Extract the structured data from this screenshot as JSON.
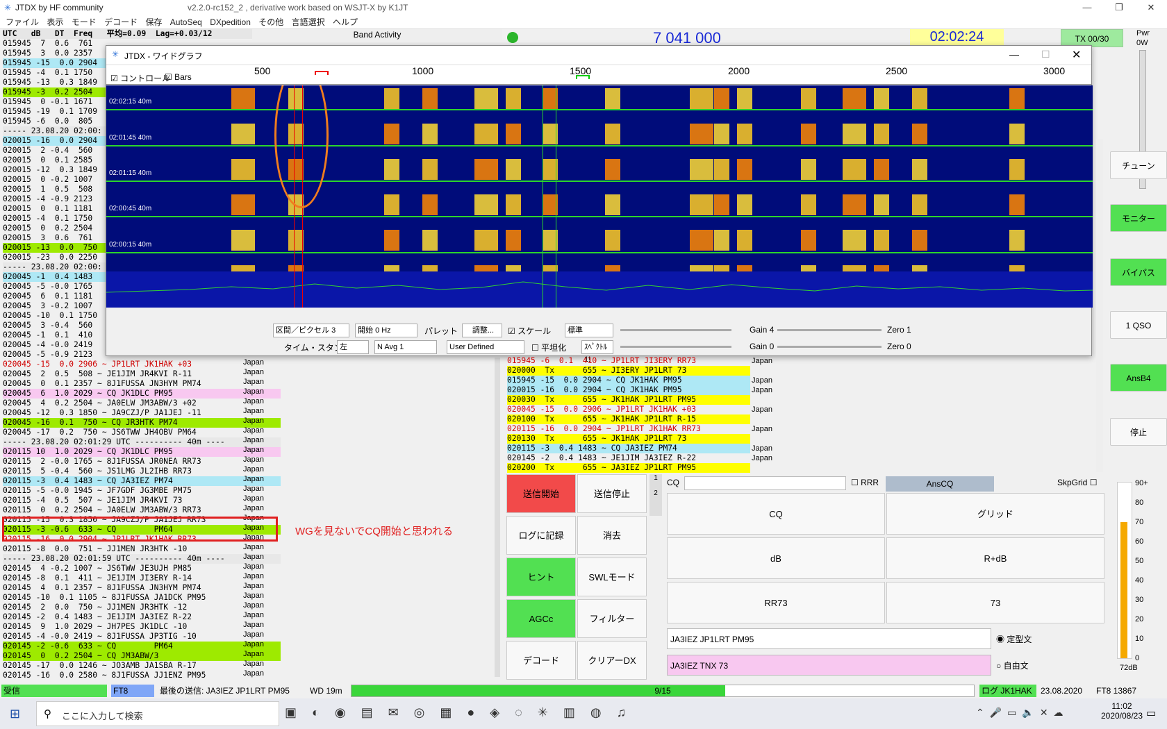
{
  "app": {
    "title": "JTDX  by HF community",
    "version": "v2.2.0-rc152_2 , derivative work based on WSJT-X by K1JT"
  },
  "menu": [
    "ファイル",
    "表示",
    "モード",
    "デコード",
    "保存",
    "AutoSeq",
    "DXpedition",
    "その他",
    "言語選択",
    "ヘルプ"
  ],
  "left_header": "UTC   dB   DT  Freq",
  "avg": "平均=0.09  Lag=+0.03/12",
  "band_activity": "Band Activity",
  "dial_freq": "7 041 000",
  "clock": "02:02:24",
  "tx_label": "TX 00/30",
  "pwr_label": "Pwr",
  "pwr_value": "0W",
  "right_buttons": [
    "チューン",
    "モニター",
    "バイパス",
    "1 QSO",
    "AnsB4",
    "停止"
  ],
  "annotation": "WGを見ないでCQ開始と思われる",
  "left_rows": [
    {
      "t": "015945  7  0.6  761",
      "c": ""
    },
    {
      "t": "015945  3  0.0 2357",
      "c": ""
    },
    {
      "t": "015945 -15  0.0 2904",
      "c": "cq"
    },
    {
      "t": "015945 -4  0.1 1750",
      "c": ""
    },
    {
      "t": "015945 -13  0.3 1849",
      "c": ""
    },
    {
      "t": "015945 -3  0.2 2504",
      "c": "me"
    },
    {
      "t": "015945  0 -0.1 1671",
      "c": ""
    },
    {
      "t": "015945 -19  0.1 1709",
      "c": ""
    },
    {
      "t": "015945 -6  0.0  805",
      "c": ""
    },
    {
      "t": "----- 23.08.20 02:00:",
      "c": "sep"
    },
    {
      "t": "020015 -16  0.0 2904",
      "c": "cq"
    },
    {
      "t": "020015  2 -0.4  560",
      "c": ""
    },
    {
      "t": "020015  0  0.1 2585",
      "c": ""
    },
    {
      "t": "020015 -12  0.3 1849",
      "c": ""
    },
    {
      "t": "020015  0 -0.2 1007",
      "c": ""
    },
    {
      "t": "020015  1  0.5  508",
      "c": ""
    },
    {
      "t": "020015 -4 -0.9 2123",
      "c": ""
    },
    {
      "t": "020015  0  0.1 1181",
      "c": ""
    },
    {
      "t": "020015 -4  0.1 1750",
      "c": ""
    },
    {
      "t": "020015  0  0.2 2504",
      "c": ""
    },
    {
      "t": "020015  3  0.6  761",
      "c": ""
    },
    {
      "t": "020015 -13  0.0  750",
      "c": "me"
    },
    {
      "t": "020015 -23  0.0 2250",
      "c": ""
    },
    {
      "t": "----- 23.08.20 02:00:",
      "c": "sep"
    },
    {
      "t": "020045 -1  0.4 1483",
      "c": "cq"
    },
    {
      "t": "020045 -5 -0.0 1765",
      "c": ""
    },
    {
      "t": "020045  6  0.1 1181",
      "c": ""
    },
    {
      "t": "020045  3 -0.2 1007",
      "c": ""
    },
    {
      "t": "020045 -10  0.1 1750",
      "c": ""
    },
    {
      "t": "020045  3 -0.4  560",
      "c": ""
    },
    {
      "t": "020045 -1  0.1  410",
      "c": ""
    },
    {
      "t": "020045 -4 -0.0 2419",
      "c": ""
    },
    {
      "t": "020045 -5 -0.9 2123",
      "c": ""
    },
    {
      "t": "020045 -15  0.0 2906 ~ JP1LRT JK1HAK +03",
      "c": "red"
    },
    {
      "t": "020045  2  0.5  508 ~ JE1JIM JR4KVI R-11",
      "c": ""
    },
    {
      "t": "020045  0  0.1 2357 ~ 8J1FUSSA JN3HYM PM74",
      "c": ""
    },
    {
      "t": "020045  6  1.0 2029 ~ CQ JK1DLC PM95",
      "c": "pink"
    },
    {
      "t": "020045  4  0.2 2504 ~ JA0ELW JM3ABW/3 +02",
      "c": ""
    },
    {
      "t": "020045 -12  0.3 1850 ~ JA9CZJ/P JA1JEJ -11",
      "c": ""
    },
    {
      "t": "020045 -16  0.1  750 ~ CQ JR3HTK PM74",
      "c": "me"
    },
    {
      "t": "020045 -17  0.2  750 ~ JS6TWW JH4OBV PM64",
      "c": ""
    },
    {
      "t": "----- 23.08.20 02:01:29 UTC ---------- 40m ----",
      "c": "sep"
    },
    {
      "t": "020115 10  1.0 2029 ~ CQ JK1DLC PM95",
      "c": "pink"
    },
    {
      "t": "020115  2 -0.0 1765 ~ 8J1FUSSA JR0NEA RR73",
      "c": ""
    },
    {
      "t": "020115  5 -0.4  560 ~ JS1LMG JL2IHB RR73",
      "c": ""
    },
    {
      "t": "020115 -3  0.4 1483 ~ CQ JA3IEZ PM74",
      "c": "cq"
    },
    {
      "t": "020115 -5 -0.0 1945 ~ JF7GDF JG3MBE PM75",
      "c": ""
    },
    {
      "t": "020115 -4  0.5  507 ~ JE1JIM JR4KVI 73",
      "c": ""
    },
    {
      "t": "020115  0  0.2 2504 ~ JA0ELW JM3ABW/3 RR73",
      "c": ""
    },
    {
      "t": "020115 -15  0.3 1850 ~ JA9CZJ/P JA1JEJ RR73",
      "c": ""
    },
    {
      "t": "020115 -3 -0.6  633 ~ CQ        PM64",
      "c": "me"
    },
    {
      "t": "020115 -16  0.0 2904 ~ JP1LRT JK1HAK RR73",
      "c": "red"
    },
    {
      "t": "020115 -8  0.0  751 ~ JJ1MEN JR3HTK -10",
      "c": ""
    },
    {
      "t": "----- 23.08.20 02:01:59 UTC ---------- 40m ----",
      "c": "sep"
    },
    {
      "t": "020145  4 -0.2 1007 ~ JS6TWW JE3UJH PM85",
      "c": ""
    },
    {
      "t": "020145 -8  0.1  411 ~ JE1JIM JI3ERY R-14",
      "c": ""
    },
    {
      "t": "020145  4  0.1 2357 ~ 8J1FUSSA JN3HYM PM74",
      "c": ""
    },
    {
      "t": "020145 -10  0.1 1105 ~ 8J1FUSSA JA1DCK PM95",
      "c": ""
    },
    {
      "t": "020145  2  0.0  750 ~ JJ1MEN JR3HTK -12",
      "c": ""
    },
    {
      "t": "020145 -2  0.4 1483 ~ JE1JIM JA3IEZ R-22",
      "c": ""
    },
    {
      "t": "020145  9  1.0 2029 ~ JH7PES JK1DLC -10",
      "c": ""
    },
    {
      "t": "020145 -4 -0.0 2419 ~ 8J1FUSSA JP3TIG -10",
      "c": ""
    },
    {
      "t": "020145 -2 -0.6  633 ~ CQ        PM64",
      "c": "me"
    },
    {
      "t": "020145  0  0.2 2504 ~ CQ JM3ABW/3",
      "c": "me"
    },
    {
      "t": "020145 -17  0.0 1246 ~ JO3AMB JA1SBA R-17",
      "c": ""
    },
    {
      "t": "020145 -16  0.0 2580 ~ 8J1FUSSA JJ1ENZ PM95",
      "c": ""
    }
  ],
  "country": "Japan",
  "wg": {
    "title": "JTDX - ワイドグラフ",
    "control_label": "コントロール",
    "bars_label": "Bars",
    "ticks": [
      "500",
      "1000",
      "1500",
      "2000",
      "2500",
      "3000"
    ],
    "times": [
      "02:02:15",
      "02:01:45",
      "02:01:15",
      "02:00:45",
      "02:00:15"
    ],
    "band": "40m",
    "bins_label": "区間／ピクセル",
    "bins_value": "3",
    "start_label": "開始",
    "start_value": "0 Hz",
    "palette_label": "パレット",
    "adjust_label": "調整...",
    "scale_label": "スケール",
    "scale_sel": "標準",
    "timestamp_label": "タイム・スタンプ",
    "timestamp_value": "左",
    "navg": "N Avg 1",
    "palette_value": "User Defined",
    "flatten_label": "平坦化",
    "spectrum": "ｽﾍﾟｸﾄﾙ 1!",
    "gain4": "Gain 4",
    "zero1": "Zero 1",
    "gain0": "Gain 0",
    "zero0": "Zero 0"
  },
  "mid_log": [
    {
      "t": "015945 -6  0.1  410 ~ JP1LRT JI3ERY RR73",
      "c": "red"
    },
    {
      "t": "020000  Tx      655 ~ JI3ERY JP1LRT 73",
      "c": "tx"
    },
    {
      "t": "015945 -15  0.0 2904 ~ CQ JK1HAK PM95",
      "c": "cq"
    },
    {
      "t": "020015 -16  0.0 2904 ~ CQ JK1HAK PM95",
      "c": "cq"
    },
    {
      "t": "020030  Tx      655 ~ JK1HAK JP1LRT PM95",
      "c": "tx"
    },
    {
      "t": "020045 -15  0.0 2906 ~ JP1LRT JK1HAK +03",
      "c": "red"
    },
    {
      "t": "020100  Tx      655 ~ JK1HAK JP1LRT R-15",
      "c": "tx"
    },
    {
      "t": "020115 -16  0.0 2904 ~ JP1LRT JK1HAK RR73",
      "c": "red"
    },
    {
      "t": "020130  Tx      655 ~ JK1HAK JP1LRT 73",
      "c": "tx"
    },
    {
      "t": "020115 -3  0.4 1483 ~ CQ JA3IEZ PM74",
      "c": "cq"
    },
    {
      "t": "020145 -2  0.4 1483 ~ JE1JIM JA3IEZ R-22",
      "c": ""
    },
    {
      "t": "020200  Tx      655 ~ JA3IEZ JP1LRT PM95",
      "c": "tx"
    }
  ],
  "buttons": {
    "tx_start": "送信開始",
    "tx_stop": "送信停止",
    "log": "ログに記録",
    "clear": "消去",
    "hint": "ヒント",
    "swl": "SWLモード",
    "agcc": "AGCc",
    "filter": "フィルター",
    "decode": "デコード",
    "cleardx": "クリアーDX"
  },
  "msg": {
    "cq_prefix": "CQ",
    "rrr": "RRR",
    "anscq": "AnsCQ",
    "skpgrid": "SkpGrid",
    "b_cq": "CQ",
    "b_grid": "グリッド",
    "b_db": "dB",
    "b_rdb": "R+dB",
    "b_rr73": "RR73",
    "b_73": "73",
    "tx_msg": "JA3IEZ JP1LRT PM95",
    "tx_free": "JA3IEZ TNX 73",
    "fixed": "定型文",
    "free": "自由文"
  },
  "meter": {
    "labels": [
      "90+",
      "80",
      "70",
      "60",
      "50",
      "40",
      "30",
      "20",
      "10",
      "0"
    ],
    "value": "72dB"
  },
  "status": {
    "rx": "受信",
    "mode": "FT8",
    "last_tx": "最後の送信: JA3IEZ JP1LRT PM95",
    "wd": "WD 19m",
    "progress": "9/15",
    "progress_frac": 0.6,
    "log_call": "ログ JK1HAK",
    "date": "23.08.2020",
    "ft8": "FT8  13867"
  },
  "taskbar": {
    "search": "ここに入力して検索",
    "time": "11:02",
    "date": "2020/08/23"
  }
}
